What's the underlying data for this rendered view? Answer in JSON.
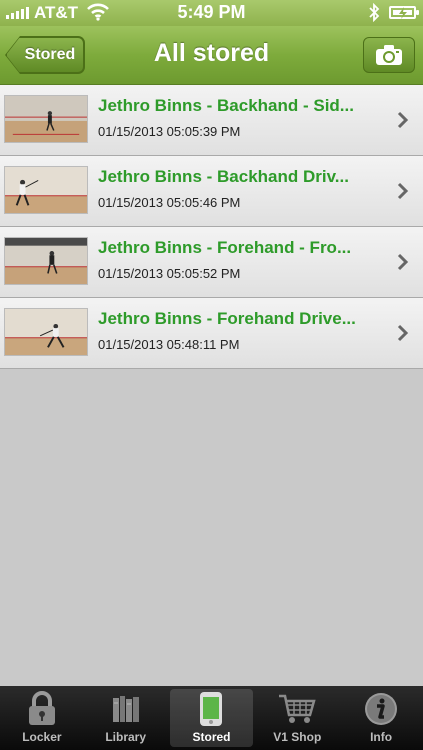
{
  "status_bar": {
    "carrier": "AT&T",
    "time": "5:49 PM"
  },
  "nav": {
    "back_label": "Stored",
    "title": "All stored",
    "right_icon": "camera-icon"
  },
  "items": [
    {
      "title": "Jethro Binns - Backhand - Sid...",
      "date": "01/15/2013 05:05:39 PM"
    },
    {
      "title": "Jethro Binns - Backhand Driv...",
      "date": "01/15/2013 05:05:46 PM"
    },
    {
      "title": "Jethro Binns - Forehand - Fro...",
      "date": "01/15/2013 05:05:52 PM"
    },
    {
      "title": "Jethro Binns - Forehand Drive...",
      "date": "01/15/2013 05:48:11 PM"
    }
  ],
  "tabs": [
    {
      "label": "Locker",
      "icon": "lock-icon"
    },
    {
      "label": "Library",
      "icon": "books-icon"
    },
    {
      "label": "Stored",
      "icon": "phone-icon",
      "active": true
    },
    {
      "label": "V1 Shop",
      "icon": "cart-icon"
    },
    {
      "label": "Info",
      "icon": "info-icon"
    }
  ],
  "colors": {
    "accent_green": "#2e9b2a",
    "nav_green": "#7eab3c"
  }
}
